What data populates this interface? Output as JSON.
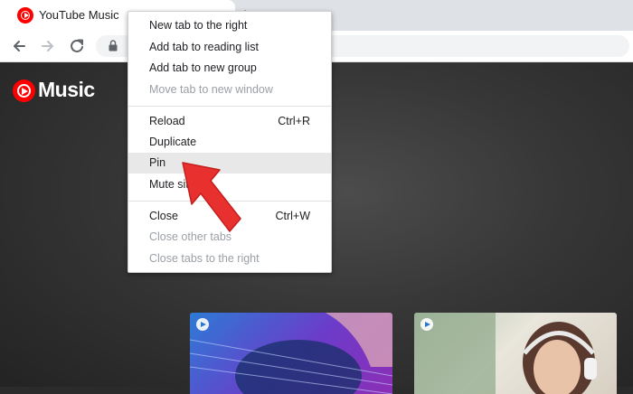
{
  "browser": {
    "tab": {
      "title": "YouTube Music",
      "favicon": "youtube-music-icon"
    },
    "new_tab_symbol": "+",
    "toolbar_icons": [
      "back-arrow-icon",
      "forward-arrow-icon",
      "reload-icon",
      "lock-icon"
    ]
  },
  "page": {
    "logo_text": "Music",
    "thumbnails": [
      {
        "name": "guitar-thumbnail",
        "badge": "play-icon"
      },
      {
        "name": "headphones-thumbnail",
        "badge": "play-icon"
      }
    ]
  },
  "context_menu": {
    "items": [
      {
        "label": "New tab to the right",
        "shortcut": "",
        "disabled": false
      },
      {
        "label": "Add tab to reading list",
        "shortcut": "",
        "disabled": false
      },
      {
        "label": "Add tab to new group",
        "shortcut": "",
        "disabled": false
      },
      {
        "label": "Move tab to new window",
        "shortcut": "",
        "disabled": true
      },
      {
        "label": "Reload",
        "shortcut": "Ctrl+R",
        "disabled": false
      },
      {
        "label": "Duplicate",
        "shortcut": "",
        "disabled": false
      },
      {
        "label": "Pin",
        "shortcut": "",
        "disabled": false,
        "highlighted": true
      },
      {
        "label": "Mute site",
        "shortcut": "",
        "disabled": false
      },
      {
        "label": "Close",
        "shortcut": "Ctrl+W",
        "disabled": false
      },
      {
        "label": "Close other tabs",
        "shortcut": "",
        "disabled": true
      },
      {
        "label": "Close tabs to the right",
        "shortcut": "",
        "disabled": true
      }
    ]
  },
  "annotation": {
    "icon": "red-arrow-pointer",
    "color": "#e8312f"
  },
  "colors": {
    "brand_red": "#ff0000",
    "menu_highlight": "#e8e8e8",
    "disabled_text": "#9aa0a6"
  }
}
